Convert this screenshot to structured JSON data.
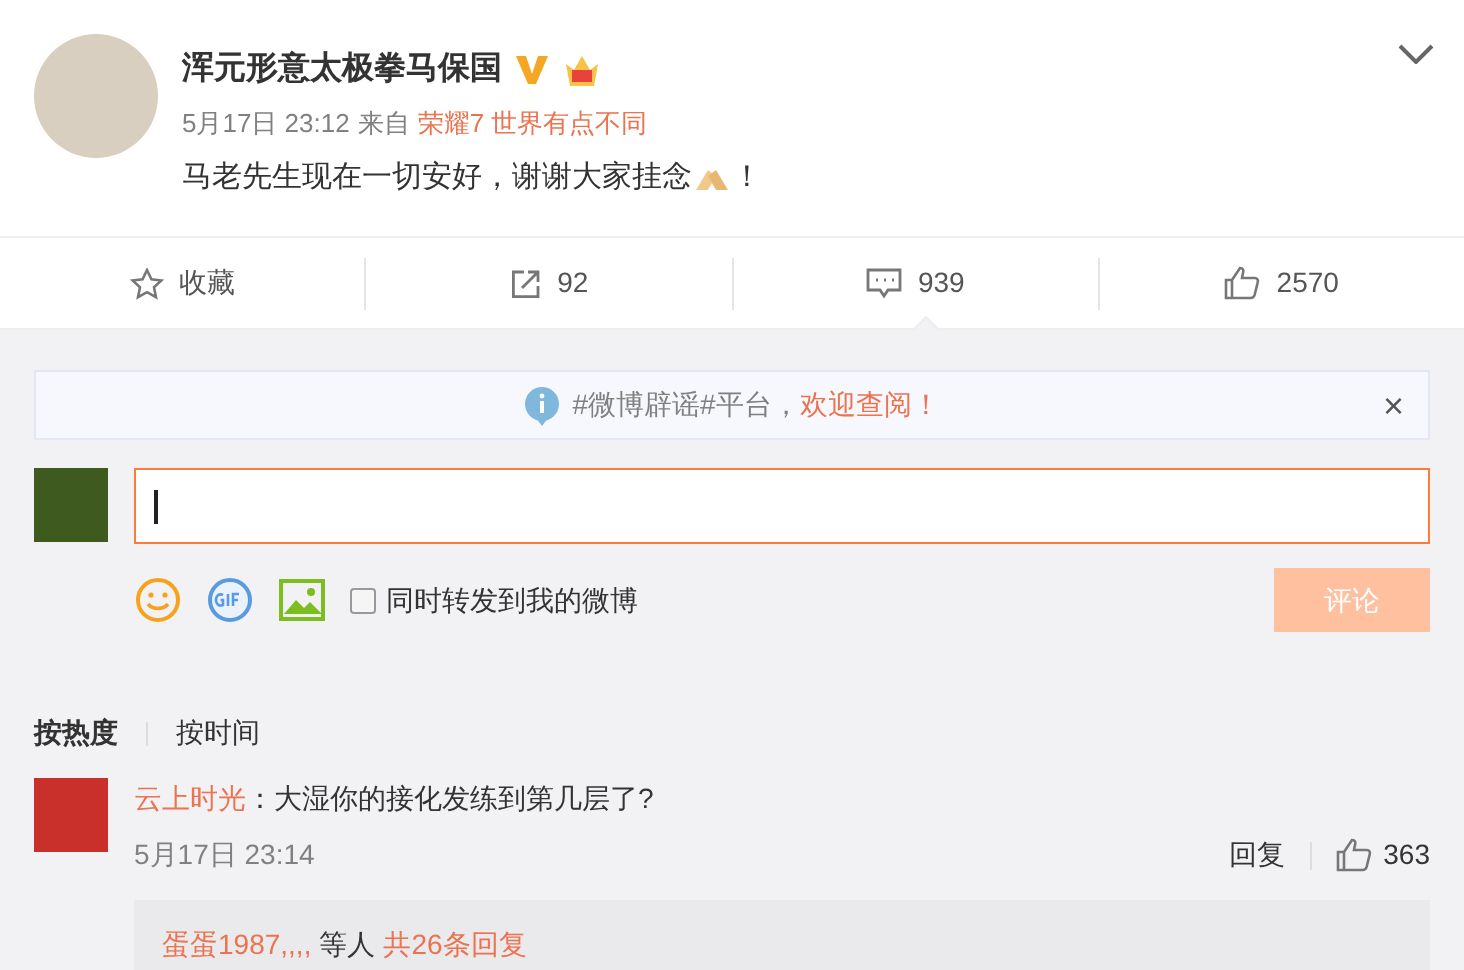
{
  "post": {
    "author": "浑元形意太极拳马保国",
    "time": "5月17日 23:12",
    "from_label": "来自",
    "source": "荣耀7 世界有点不同",
    "text_before": "马老先生现在一切安好，谢谢大家挂念",
    "text_after": "！"
  },
  "actions": [
    {
      "kind": "favorite",
      "label": "收藏"
    },
    {
      "kind": "repost",
      "label": "92"
    },
    {
      "kind": "comment",
      "label": "939"
    },
    {
      "kind": "like",
      "label": "2570"
    }
  ],
  "notice": {
    "text": "#微博辟谣#平台，",
    "link": "欢迎查阅！",
    "close": "×"
  },
  "composer": {
    "also_repost": {
      "label": "同时转发到我的微博",
      "checked": false
    },
    "submit": "评论"
  },
  "sort_tabs": [
    {
      "label": "按热度",
      "selected": true
    },
    {
      "label": "按时间",
      "selected": false
    }
  ],
  "comments": [
    {
      "user": "云上时光",
      "text": "：大湿你的接化发练到第几层了?",
      "time": "5月17日 23:14",
      "reply": "回复",
      "likes": "363",
      "replies": {
        "users": "蛋蛋1987,,,,",
        "others": "等人",
        "count": "共26条回复"
      }
    }
  ]
}
